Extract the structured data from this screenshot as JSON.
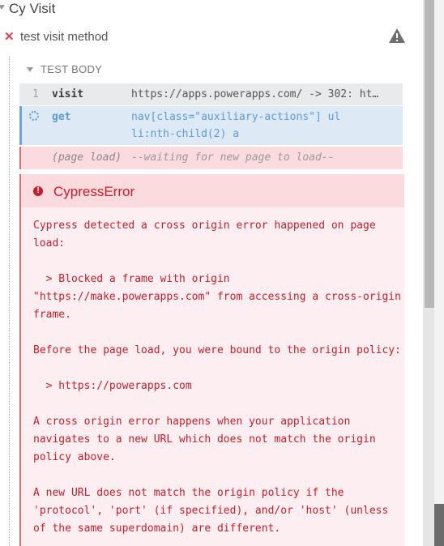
{
  "suite": {
    "title": "Cy Visit"
  },
  "test": {
    "title": "test visit method",
    "status": "failed"
  },
  "test_body": {
    "label": "TEST BODY"
  },
  "commands": [
    {
      "number": "1",
      "name": "visit",
      "message": "https://apps.powerapps.com/ -> 302: ht…"
    },
    {
      "number": "",
      "name": "get",
      "message": "nav[class=\"auxiliary-actions\"] ul li:nth-child(2) a"
    },
    {
      "number": "",
      "name": "(page load)",
      "message": "--waiting for new page to load--"
    }
  ],
  "error": {
    "title": "CypressError",
    "message": "Cypress detected a cross origin error happened on page load:\n\n  > Blocked a frame with origin \"https://make.powerapps.com\" from accessing a cross-origin frame.\n\nBefore the page load, you were bound to the origin policy:\n\n  > https://powerapps.com\n\nA cross origin error happens when your application navigates to a new URL which does not match the origin policy above.\n\nA new URL does not match the origin policy if the 'protocol', 'port' (if specified), and/or 'host' (unless of the same superdomain) are different."
  },
  "colors": {
    "error": "#c71d2a",
    "pending": "#5b9bd5",
    "fail_x": "#e0424b"
  },
  "icons": {
    "suite_caret": "caret-down-icon",
    "fail": "close-icon",
    "warning": "warning-icon",
    "loading": "spinner-icon"
  }
}
